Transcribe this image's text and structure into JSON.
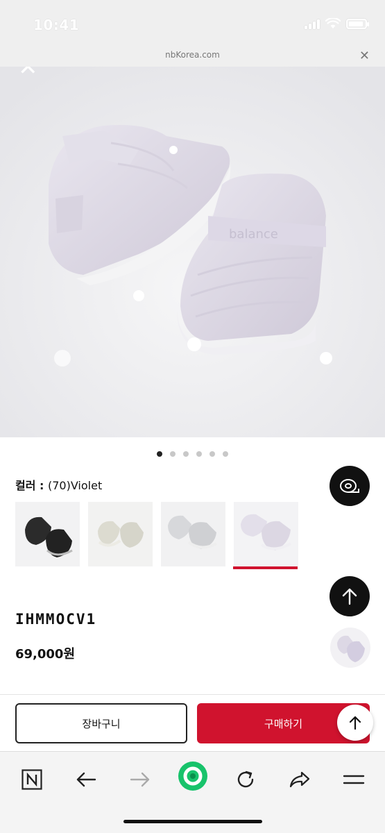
{
  "status_bar": {
    "time": "10:41"
  },
  "browser": {
    "url": "nbKorea.com"
  },
  "carousel": {
    "total": 6,
    "active_index": 0
  },
  "product": {
    "color_label": "컬러 : ",
    "color_value": "(70)Violet",
    "swatches": [
      {
        "name": "black",
        "fill": "#2b2b2b"
      },
      {
        "name": "cream",
        "fill": "#dcdbd0"
      },
      {
        "name": "grey",
        "fill": "#cfd0d3"
      },
      {
        "name": "violet",
        "fill": "#dcd7e3",
        "selected": true
      }
    ],
    "code": "IHMMOCV1",
    "price": "69,000원"
  },
  "actions": {
    "cart_label": "장바구니",
    "buy_label": "구매하기"
  },
  "colors": {
    "accent_red": "#d0132e",
    "dark": "#111111"
  },
  "icons": {
    "hero_close": "close-icon",
    "size_guide": "tape-measure-icon",
    "scroll_top": "arrow-up-icon",
    "toolbar": [
      "naver-n-icon",
      "back-arrow-icon",
      "forward-arrow-icon",
      "green-home-icon",
      "refresh-icon",
      "share-icon",
      "menu-icon"
    ]
  }
}
